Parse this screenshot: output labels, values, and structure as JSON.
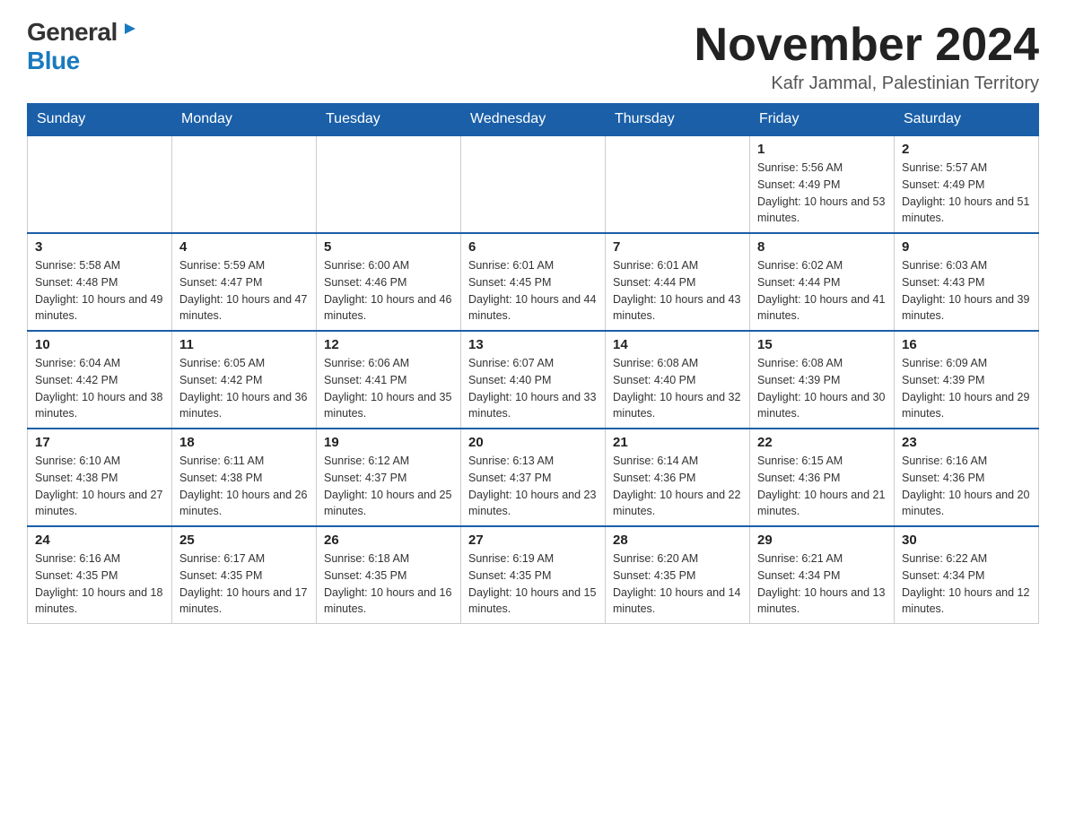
{
  "logo": {
    "general": "General",
    "blue": "Blue"
  },
  "title": "November 2024",
  "location": "Kafr Jammal, Palestinian Territory",
  "days_of_week": [
    "Sunday",
    "Monday",
    "Tuesday",
    "Wednesday",
    "Thursday",
    "Friday",
    "Saturday"
  ],
  "weeks": [
    [
      {
        "day": "",
        "info": ""
      },
      {
        "day": "",
        "info": ""
      },
      {
        "day": "",
        "info": ""
      },
      {
        "day": "",
        "info": ""
      },
      {
        "day": "",
        "info": ""
      },
      {
        "day": "1",
        "info": "Sunrise: 5:56 AM\nSunset: 4:49 PM\nDaylight: 10 hours and 53 minutes."
      },
      {
        "day": "2",
        "info": "Sunrise: 5:57 AM\nSunset: 4:49 PM\nDaylight: 10 hours and 51 minutes."
      }
    ],
    [
      {
        "day": "3",
        "info": "Sunrise: 5:58 AM\nSunset: 4:48 PM\nDaylight: 10 hours and 49 minutes."
      },
      {
        "day": "4",
        "info": "Sunrise: 5:59 AM\nSunset: 4:47 PM\nDaylight: 10 hours and 47 minutes."
      },
      {
        "day": "5",
        "info": "Sunrise: 6:00 AM\nSunset: 4:46 PM\nDaylight: 10 hours and 46 minutes."
      },
      {
        "day": "6",
        "info": "Sunrise: 6:01 AM\nSunset: 4:45 PM\nDaylight: 10 hours and 44 minutes."
      },
      {
        "day": "7",
        "info": "Sunrise: 6:01 AM\nSunset: 4:44 PM\nDaylight: 10 hours and 43 minutes."
      },
      {
        "day": "8",
        "info": "Sunrise: 6:02 AM\nSunset: 4:44 PM\nDaylight: 10 hours and 41 minutes."
      },
      {
        "day": "9",
        "info": "Sunrise: 6:03 AM\nSunset: 4:43 PM\nDaylight: 10 hours and 39 minutes."
      }
    ],
    [
      {
        "day": "10",
        "info": "Sunrise: 6:04 AM\nSunset: 4:42 PM\nDaylight: 10 hours and 38 minutes."
      },
      {
        "day": "11",
        "info": "Sunrise: 6:05 AM\nSunset: 4:42 PM\nDaylight: 10 hours and 36 minutes."
      },
      {
        "day": "12",
        "info": "Sunrise: 6:06 AM\nSunset: 4:41 PM\nDaylight: 10 hours and 35 minutes."
      },
      {
        "day": "13",
        "info": "Sunrise: 6:07 AM\nSunset: 4:40 PM\nDaylight: 10 hours and 33 minutes."
      },
      {
        "day": "14",
        "info": "Sunrise: 6:08 AM\nSunset: 4:40 PM\nDaylight: 10 hours and 32 minutes."
      },
      {
        "day": "15",
        "info": "Sunrise: 6:08 AM\nSunset: 4:39 PM\nDaylight: 10 hours and 30 minutes."
      },
      {
        "day": "16",
        "info": "Sunrise: 6:09 AM\nSunset: 4:39 PM\nDaylight: 10 hours and 29 minutes."
      }
    ],
    [
      {
        "day": "17",
        "info": "Sunrise: 6:10 AM\nSunset: 4:38 PM\nDaylight: 10 hours and 27 minutes."
      },
      {
        "day": "18",
        "info": "Sunrise: 6:11 AM\nSunset: 4:38 PM\nDaylight: 10 hours and 26 minutes."
      },
      {
        "day": "19",
        "info": "Sunrise: 6:12 AM\nSunset: 4:37 PM\nDaylight: 10 hours and 25 minutes."
      },
      {
        "day": "20",
        "info": "Sunrise: 6:13 AM\nSunset: 4:37 PM\nDaylight: 10 hours and 23 minutes."
      },
      {
        "day": "21",
        "info": "Sunrise: 6:14 AM\nSunset: 4:36 PM\nDaylight: 10 hours and 22 minutes."
      },
      {
        "day": "22",
        "info": "Sunrise: 6:15 AM\nSunset: 4:36 PM\nDaylight: 10 hours and 21 minutes."
      },
      {
        "day": "23",
        "info": "Sunrise: 6:16 AM\nSunset: 4:36 PM\nDaylight: 10 hours and 20 minutes."
      }
    ],
    [
      {
        "day": "24",
        "info": "Sunrise: 6:16 AM\nSunset: 4:35 PM\nDaylight: 10 hours and 18 minutes."
      },
      {
        "day": "25",
        "info": "Sunrise: 6:17 AM\nSunset: 4:35 PM\nDaylight: 10 hours and 17 minutes."
      },
      {
        "day": "26",
        "info": "Sunrise: 6:18 AM\nSunset: 4:35 PM\nDaylight: 10 hours and 16 minutes."
      },
      {
        "day": "27",
        "info": "Sunrise: 6:19 AM\nSunset: 4:35 PM\nDaylight: 10 hours and 15 minutes."
      },
      {
        "day": "28",
        "info": "Sunrise: 6:20 AM\nSunset: 4:35 PM\nDaylight: 10 hours and 14 minutes."
      },
      {
        "day": "29",
        "info": "Sunrise: 6:21 AM\nSunset: 4:34 PM\nDaylight: 10 hours and 13 minutes."
      },
      {
        "day": "30",
        "info": "Sunrise: 6:22 AM\nSunset: 4:34 PM\nDaylight: 10 hours and 12 minutes."
      }
    ]
  ]
}
